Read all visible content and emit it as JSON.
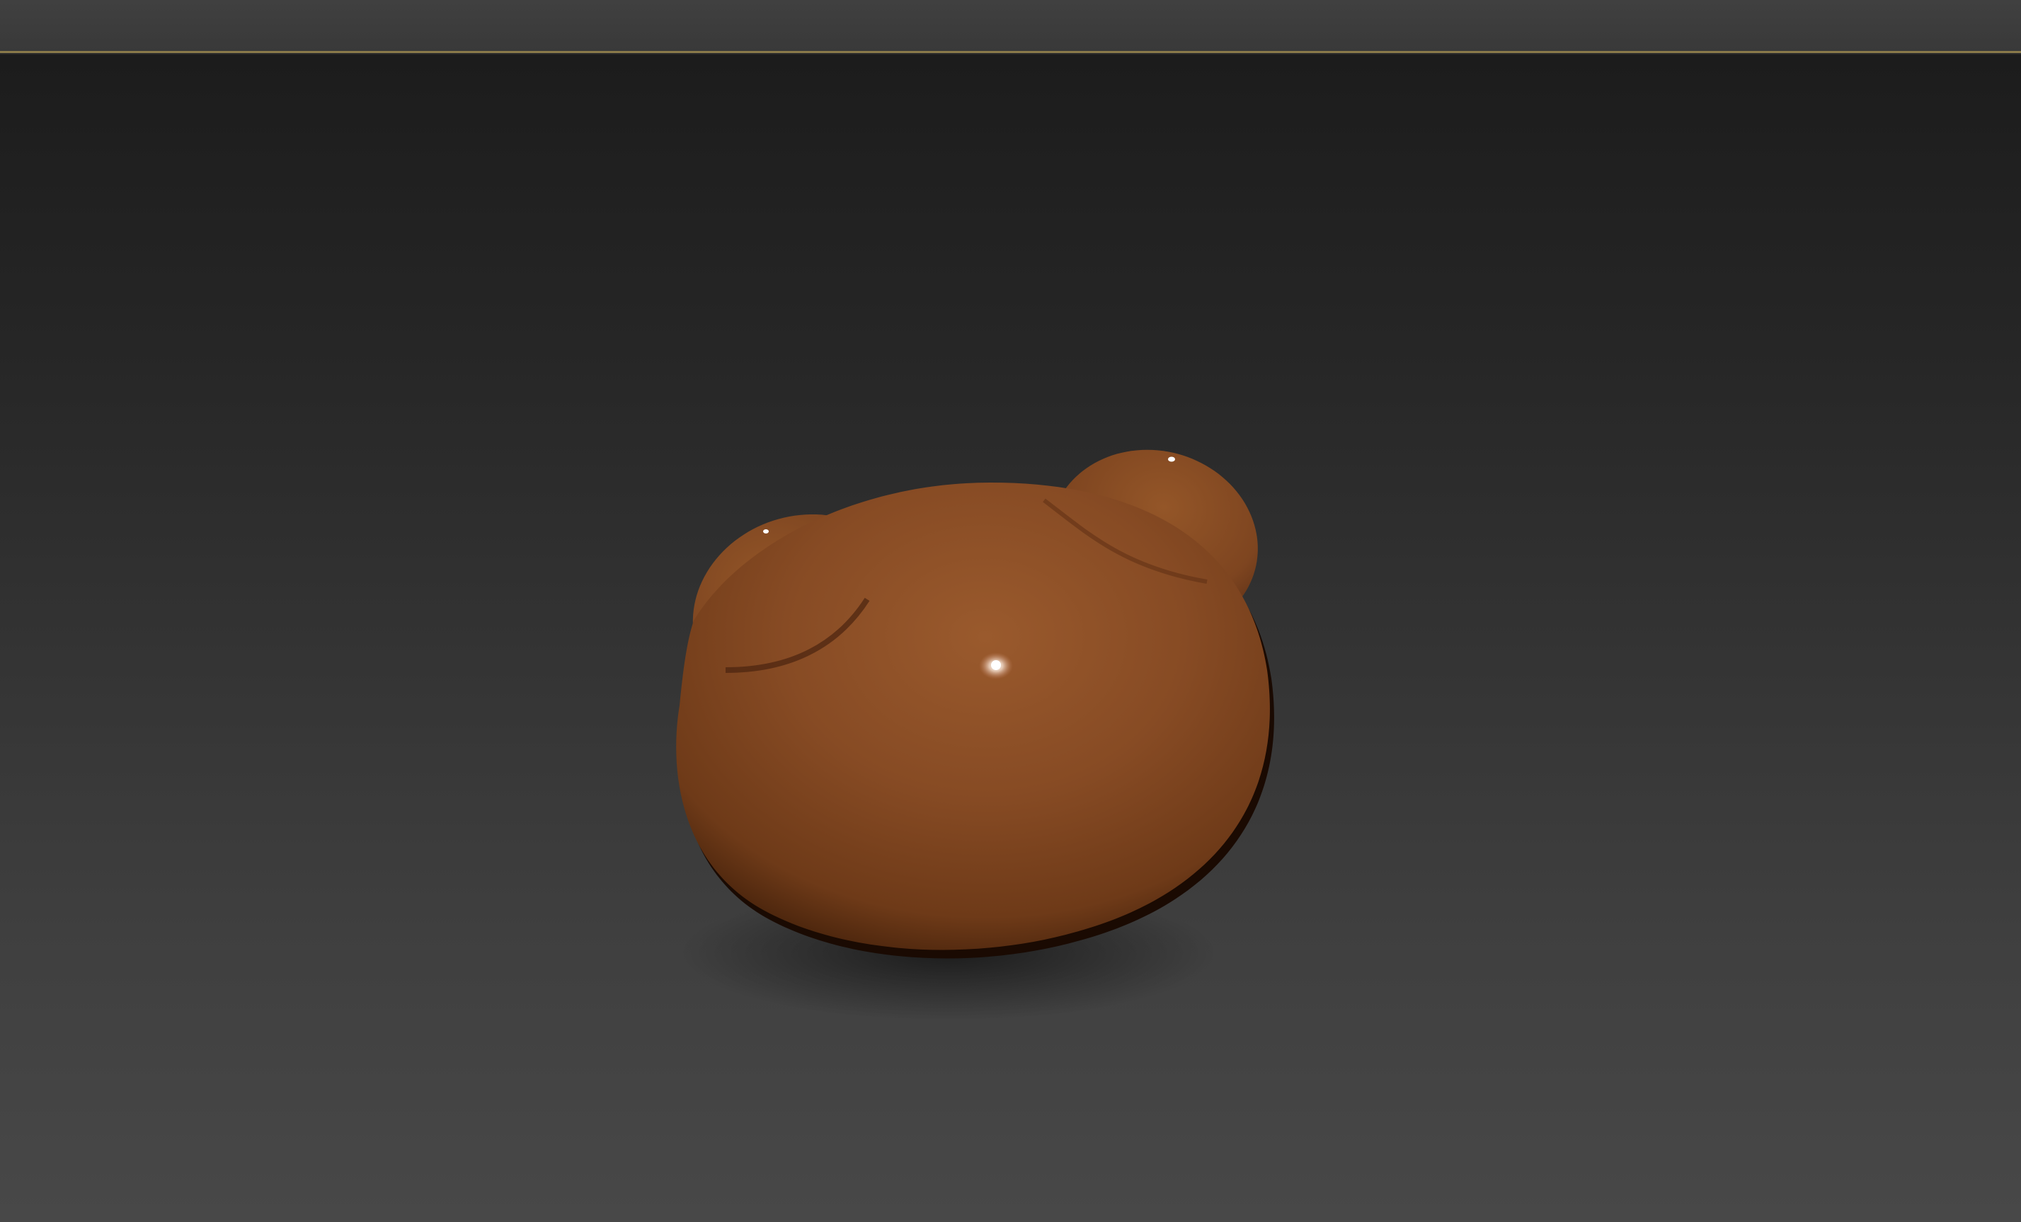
{
  "app": {
    "viewport": {
      "label": "",
      "background_top": "#1c1c1c",
      "background_bottom": "#484848",
      "active_border_color": "#8a7a4a"
    },
    "object": {
      "description_name": "bear-head",
      "material_color": "#8b4f28",
      "highlight_color": "#ffffff",
      "shadow_color": "#1a0a02"
    }
  }
}
